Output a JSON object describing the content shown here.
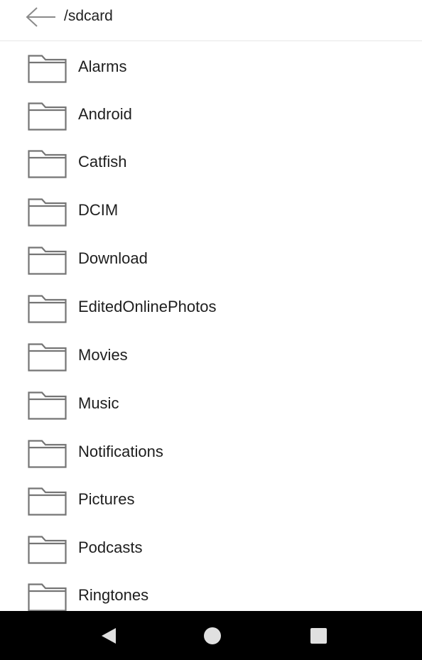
{
  "header": {
    "back_icon": "arrow-left-icon",
    "path": "/sdcard"
  },
  "folders": [
    {
      "name": "Alarms",
      "icon": "folder-icon"
    },
    {
      "name": "Android",
      "icon": "folder-icon"
    },
    {
      "name": "Catfish",
      "icon": "folder-icon"
    },
    {
      "name": "DCIM",
      "icon": "folder-icon"
    },
    {
      "name": "Download",
      "icon": "folder-icon"
    },
    {
      "name": "EditedOnlinePhotos",
      "icon": "folder-icon"
    },
    {
      "name": "Movies",
      "icon": "folder-icon"
    },
    {
      "name": "Music",
      "icon": "folder-icon"
    },
    {
      "name": "Notifications",
      "icon": "folder-icon"
    },
    {
      "name": "Pictures",
      "icon": "folder-icon"
    },
    {
      "name": "Podcasts",
      "icon": "folder-icon"
    },
    {
      "name": "Ringtones",
      "icon": "folder-icon"
    }
  ],
  "navbar": {
    "back_icon": "triangle-back-icon",
    "home_icon": "circle-home-icon",
    "recents_icon": "square-recents-icon"
  },
  "colors": {
    "background": "#ffffff",
    "text": "#1e1e1e",
    "icon_stroke": "#757575",
    "navbar": "#000000",
    "nav_icon": "#e0e0e0"
  }
}
